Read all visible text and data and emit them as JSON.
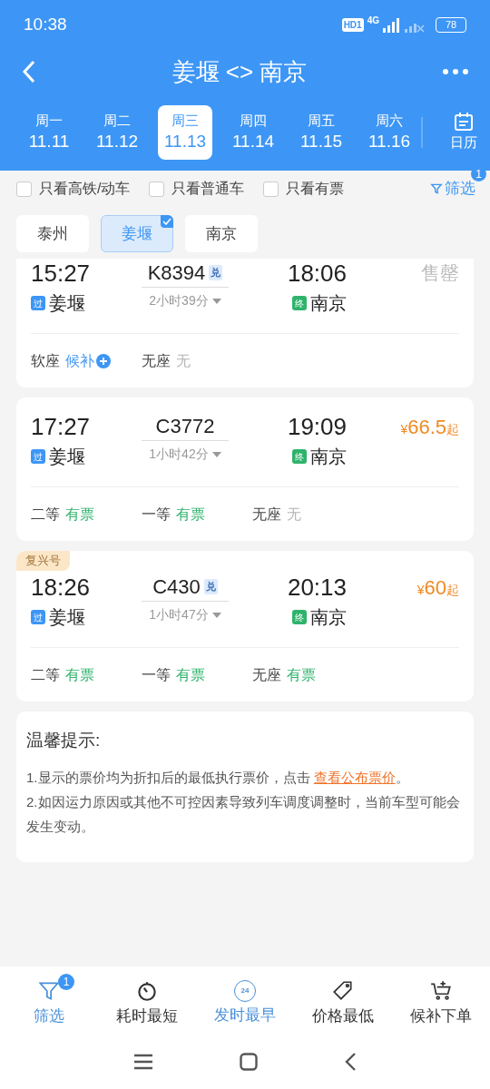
{
  "status_bar": {
    "time": "10:38",
    "hd": "HD1",
    "network": "4G",
    "battery": "78"
  },
  "header": {
    "title": "姜堰 <> 南京"
  },
  "dates": [
    {
      "weekday": "周一",
      "date": "11.11",
      "selected": false
    },
    {
      "weekday": "周二",
      "date": "11.12",
      "selected": false
    },
    {
      "weekday": "周三",
      "date": "11.13",
      "selected": true
    },
    {
      "weekday": "周四",
      "date": "11.14",
      "selected": false
    },
    {
      "weekday": "周五",
      "date": "11.15",
      "selected": false
    },
    {
      "weekday": "周六",
      "date": "11.16",
      "selected": false
    }
  ],
  "calendar_label": "日历",
  "filters": [
    {
      "label": "只看高铁/动车",
      "checked": false
    },
    {
      "label": "只看普通车",
      "checked": false
    },
    {
      "label": "只看有票",
      "checked": false
    }
  ],
  "filter_button": {
    "label": "筛选",
    "badge": "1"
  },
  "stations": [
    {
      "label": "泰州",
      "selected": false
    },
    {
      "label": "姜堰",
      "selected": true
    },
    {
      "label": "南京",
      "selected": false
    }
  ],
  "trains": [
    {
      "depart_time": "15:27",
      "depart_tag": "过",
      "depart_station": "姜堰",
      "number": "K8394",
      "exchange": "兑",
      "duration": "2小时39分",
      "arrive_time": "18:06",
      "arrive_tag": "终",
      "arrive_station": "南京",
      "status": "售罄",
      "seats": [
        {
          "class": "软座",
          "availability": "候补",
          "kind": "waitlist"
        },
        {
          "class": "无座",
          "availability": "无",
          "kind": "none"
        }
      ]
    },
    {
      "depart_time": "17:27",
      "depart_tag": "过",
      "depart_station": "姜堰",
      "number": "C3772",
      "duration": "1小时42分",
      "arrive_time": "19:09",
      "arrive_tag": "终",
      "arrive_station": "南京",
      "price_symbol": "¥",
      "price": "66.5",
      "price_suffix": "起",
      "seats": [
        {
          "class": "二等",
          "availability": "有票",
          "kind": "available"
        },
        {
          "class": "一等",
          "availability": "有票",
          "kind": "available"
        },
        {
          "class": "无座",
          "availability": "无",
          "kind": "none"
        }
      ]
    },
    {
      "badge": "复兴号",
      "depart_time": "18:26",
      "depart_tag": "过",
      "depart_station": "姜堰",
      "number": "C430",
      "exchange": "兑",
      "duration": "1小时47分",
      "arrive_time": "20:13",
      "arrive_tag": "终",
      "arrive_station": "南京",
      "price_symbol": "¥",
      "price": "60",
      "price_suffix": "起",
      "seats": [
        {
          "class": "二等",
          "availability": "有票",
          "kind": "available"
        },
        {
          "class": "一等",
          "availability": "有票",
          "kind": "available"
        },
        {
          "class": "无座",
          "availability": "有票",
          "kind": "available"
        }
      ]
    }
  ],
  "tips": {
    "title": "温馨提示:",
    "items": [
      {
        "text": "1.显示的票价均为折扣后的最低执行票价，点击 ",
        "link": "查看公布票价",
        "after": "。"
      },
      {
        "text": "2.如因运力原因或其他不可控因素导致列车调度调整时，当前车型可能会发生变动。"
      }
    ]
  },
  "bottom_nav": [
    {
      "label": "筛选",
      "selected": true,
      "badge": "1",
      "kind": "filter"
    },
    {
      "label": "耗时最短",
      "selected": false,
      "kind": "timer"
    },
    {
      "label": "发时最早",
      "selected": true,
      "kind": "clock24",
      "icon_text": "24"
    },
    {
      "label": "价格最低",
      "selected": false,
      "kind": "tag"
    },
    {
      "label": "候补下单",
      "selected": false,
      "kind": "cart"
    }
  ]
}
